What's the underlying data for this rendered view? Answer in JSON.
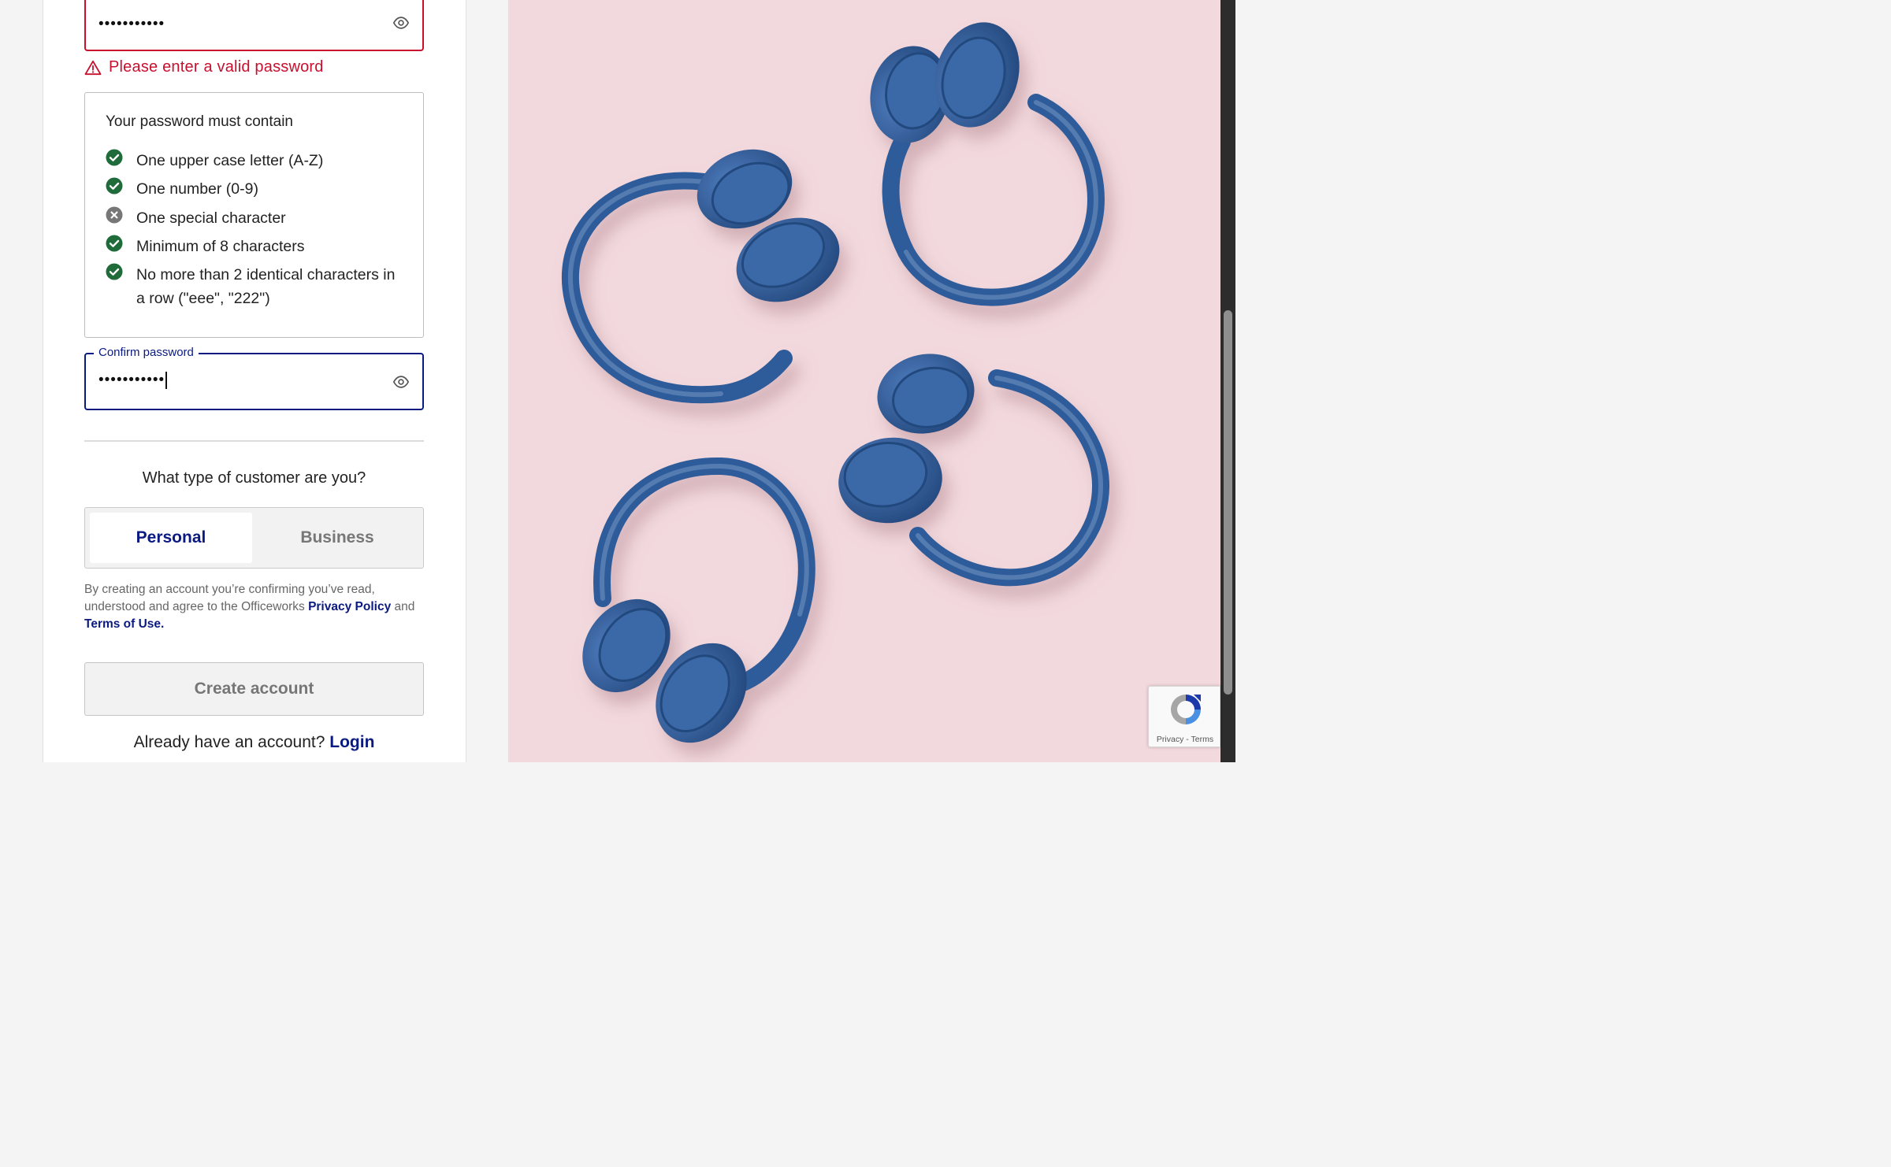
{
  "password": {
    "masked_value": "•••••••••••",
    "error_message": "Please enter a valid password"
  },
  "rules": {
    "title": "Your password must contain",
    "items": [
      {
        "label": "One upper case letter (A-Z)",
        "met": true
      },
      {
        "label": "One number (0-9)",
        "met": true
      },
      {
        "label": "One special character",
        "met": false
      },
      {
        "label": "Minimum of 8 characters",
        "met": true
      },
      {
        "label": "No more than 2 identical characters in a row (\"eee\", \"222\")",
        "met": true
      }
    ]
  },
  "confirm": {
    "label": "Confirm password",
    "masked_value": "•••••••••••"
  },
  "customer_type": {
    "question": "What type of customer are you?",
    "options": [
      "Personal",
      "Business"
    ],
    "selected": "Personal"
  },
  "consent": {
    "text_before": "By creating an account you’re confirming you’ve read, understood and agree to the Officeworks ",
    "privacy_link": "Privacy Policy",
    "text_middle": " and ",
    "terms_link": "Terms of Use."
  },
  "create_button": "Create account",
  "login": {
    "prompt": "Already have an account? ",
    "link": "Login"
  },
  "recaptcha": {
    "privacy": "Privacy",
    "separator": " - ",
    "terms": "Terms"
  },
  "colors": {
    "brand_navy": "#0b1a80",
    "error_red": "#c8102e",
    "success_green": "#1f6b3a",
    "unmet_grey": "#777777",
    "hero_pink": "#f2d9dd",
    "headphone_blue": "#2d5c9a"
  },
  "icons": {
    "show_password": "eye-icon",
    "error": "warning-triangle-icon",
    "rule_met": "check-circle-icon",
    "rule_unmet": "x-circle-icon",
    "captcha": "recaptcha-logo-icon"
  },
  "hero_image": {
    "subject": "four blue headphones on pink background"
  }
}
